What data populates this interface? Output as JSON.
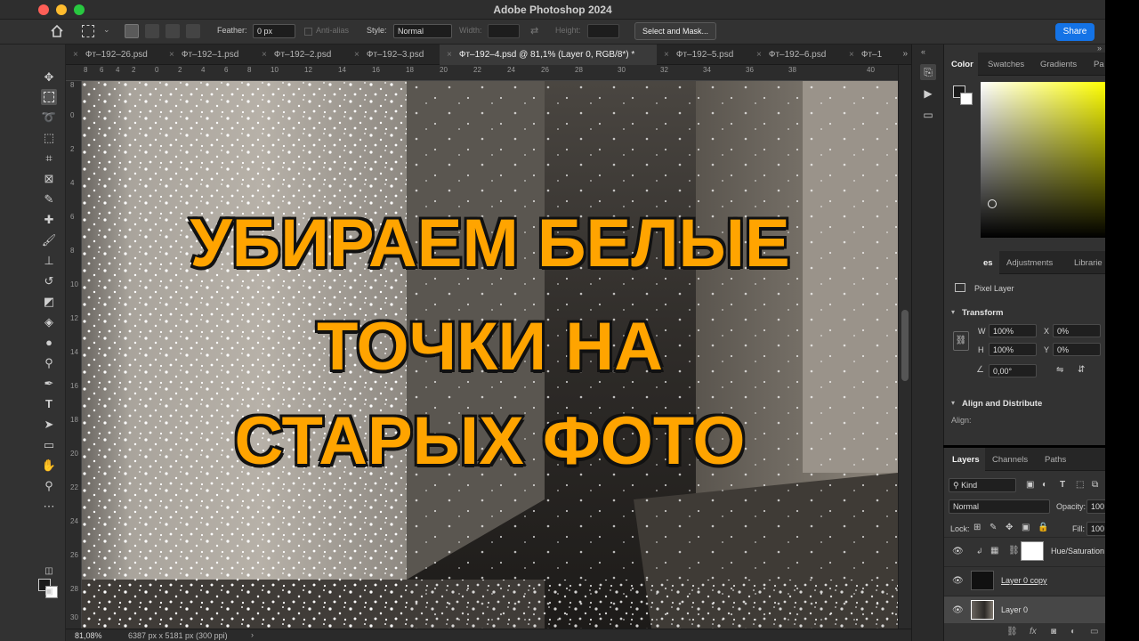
{
  "window": {
    "title": "Adobe Photoshop 2024"
  },
  "options_bar": {
    "feather_label": "Feather:",
    "feather_value": "0 px",
    "anti_alias_label": "Anti-alias",
    "style_label": "Style:",
    "style_value": "Normal",
    "width_label": "Width:",
    "height_label": "Height:",
    "select_mask_label": "Select and Mask...",
    "share_label": "Share"
  },
  "tabs": [
    {
      "label": "Фт–192–26.psd",
      "active": false
    },
    {
      "label": "Фт–192–1.psd",
      "active": false
    },
    {
      "label": "Фт–192–2.psd",
      "active": false
    },
    {
      "label": "Фт–192–3.psd",
      "active": false
    },
    {
      "label": "Фт–192–4.psd @ 81,1% (Layer 0, RGB/8*) *",
      "active": true
    },
    {
      "label": "Фт–192–5.psd",
      "active": false
    },
    {
      "label": "Фт–192–6.psd",
      "active": false
    },
    {
      "label": "Фт–1",
      "active": false
    }
  ],
  "ruler": {
    "top": [
      "8",
      "6",
      "4",
      "2",
      "0",
      "2",
      "4",
      "6",
      "8",
      "10",
      "12",
      "14",
      "16",
      "18",
      "20",
      "22",
      "24",
      "26",
      "28",
      "30",
      "32",
      "34",
      "36",
      "38",
      "40"
    ],
    "left": [
      "8",
      "0",
      "2",
      "4",
      "6",
      "8",
      "10",
      "12",
      "14",
      "16",
      "18",
      "20",
      "22",
      "24",
      "26",
      "28",
      "30"
    ]
  },
  "overlay": {
    "line1": "УБИРАЕМ БЕЛЫЕ",
    "line2": "ТОЧКИ НА",
    "line3": "СТАРЫХ ФОТО",
    "color": "#ffa400"
  },
  "status": {
    "zoom": "81,08%",
    "doc_size": "6387 px x 5181 px (300 ppi)"
  },
  "color_panel": {
    "tabs": [
      "Color",
      "Swatches",
      "Gradients",
      "Pa"
    ]
  },
  "properties_panel": {
    "tabs": [
      "es",
      "Adjustments",
      "Librarie"
    ],
    "pixel_layer": "Pixel Layer",
    "transform_title": "Transform",
    "w_label": "W",
    "w_value": "100%",
    "h_label": "H",
    "h_value": "100%",
    "x_label": "X",
    "x_value": "0%",
    "y_label": "Y",
    "y_value": "0%",
    "angle_value": "0,00°",
    "align_title": "Align and Distribute",
    "align_label": "Align:"
  },
  "layers_panel": {
    "tabs": [
      "Layers",
      "Channels",
      "Paths"
    ],
    "kind_label": "Kind",
    "blend_mode": "Normal",
    "opacity_label": "Opacity:",
    "opacity_value": "100",
    "lock_label": "Lock:",
    "fill_label": "Fill:",
    "fill_value": "100",
    "layers": [
      {
        "name": "Hue/Saturation"
      },
      {
        "name": "Layer 0 copy"
      },
      {
        "name": "Layer 0"
      }
    ]
  },
  "icons": {
    "home": "home-icon",
    "marquee": "rectangular-marquee-icon"
  }
}
